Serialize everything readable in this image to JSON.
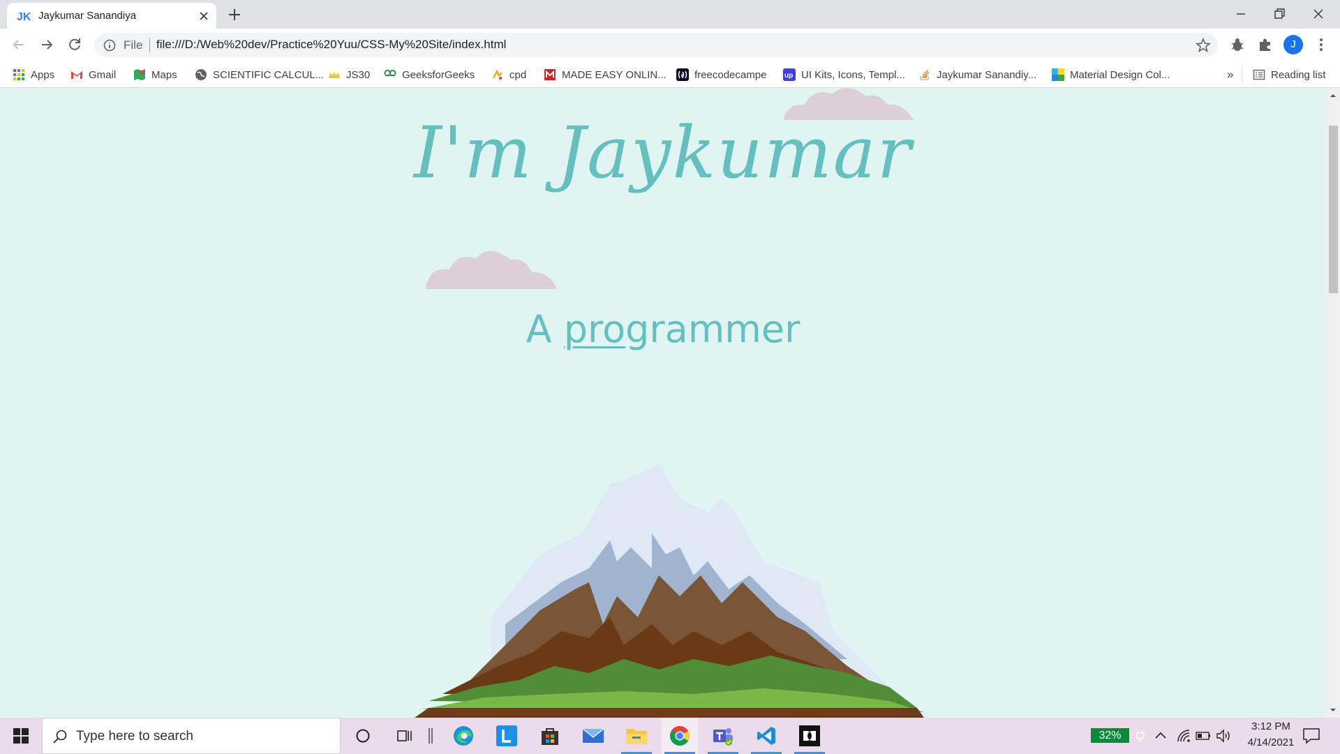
{
  "browser": {
    "tab_title": "Jaykumar Sanandiya",
    "address_scheme": "File",
    "address_url": "file:///D:/Web%20dev/Practice%20Yuu/CSS-My%20Site/index.html",
    "profile_initial": "J"
  },
  "bookmarks": {
    "items": [
      {
        "label": "Apps",
        "icon": "apps-grid-icon"
      },
      {
        "label": "Gmail",
        "icon": "gmail-icon"
      },
      {
        "label": "Maps",
        "icon": "maps-icon"
      },
      {
        "label": "SCIENTIFIC CALCUL...",
        "icon": "globe-icon"
      },
      {
        "label": "JS30",
        "icon": "crown-icon"
      },
      {
        "label": "GeeksforGeeks",
        "icon": "gfg-icon"
      },
      {
        "label": "cpd",
        "icon": "cpd-icon"
      },
      {
        "label": "MADE EASY ONLIN...",
        "icon": "madeeasy-icon"
      },
      {
        "label": "freecodecampe",
        "icon": "fcc-icon"
      },
      {
        "label": "UI Kits, Icons, Templ...",
        "icon": "uplabs-icon"
      },
      {
        "label": "Jaykumar Sanandiy...",
        "icon": "stackoverflow-icon"
      },
      {
        "label": "Material Design Col...",
        "icon": "material-icon"
      }
    ],
    "overflow": "»",
    "reading_list": "Reading list"
  },
  "page": {
    "title": "I'm Jaykumar",
    "subtitle_prefix": "A ",
    "subtitle_underlined": "pro",
    "subtitle_rest": "grammer",
    "colors": {
      "background": "#e0f5f2",
      "accent": "#66bfbf",
      "cloud": "#dccfd6"
    }
  },
  "taskbar": {
    "search_placeholder": "Type here to search",
    "battery": "32%",
    "time": "3:12 PM",
    "date": "4/14/2021"
  }
}
